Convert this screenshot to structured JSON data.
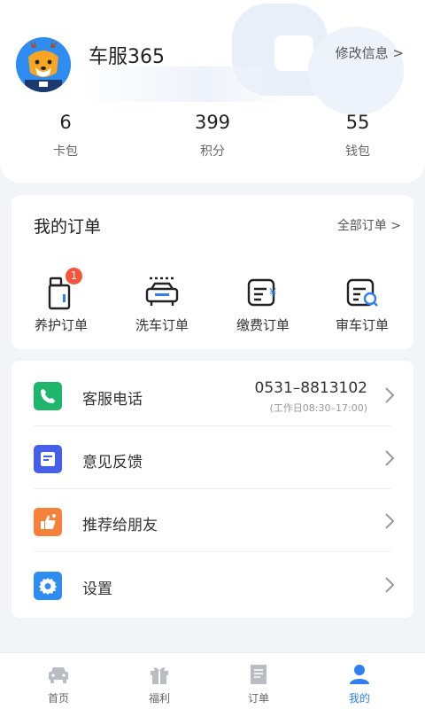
{
  "profile": {
    "username": "车服365",
    "edit_label": "修改信息 >"
  },
  "stats": [
    {
      "value": "6",
      "label": "卡包"
    },
    {
      "value": "399",
      "label": "积分"
    },
    {
      "value": "55",
      "label": "钱包"
    }
  ],
  "orders": {
    "title": "我的订单",
    "all_label": "全部订单 >",
    "items": [
      {
        "label": "养护订单",
        "icon": "maintenance-icon",
        "badge": "1"
      },
      {
        "label": "洗车订单",
        "icon": "car-wash-icon"
      },
      {
        "label": "缴费订单",
        "icon": "payment-icon"
      },
      {
        "label": "审车订单",
        "icon": "inspection-icon"
      }
    ]
  },
  "menu": {
    "items": [
      {
        "label": "客服电话",
        "icon": "phone-icon",
        "color": "#1fb56b",
        "value": "0531–8813102",
        "sub": "(工作日08:30–17:00)"
      },
      {
        "label": "意见反馈",
        "icon": "feedback-icon",
        "color": "#4560e6"
      },
      {
        "label": "推荐给朋友",
        "icon": "thumbs-up-icon",
        "color": "#f5813a"
      },
      {
        "label": "设置",
        "icon": "settings-icon",
        "color": "#2f8cf0"
      }
    ]
  },
  "tabbar": {
    "items": [
      {
        "label": "首页",
        "icon": "car-icon"
      },
      {
        "label": "福利",
        "icon": "gift-icon"
      },
      {
        "label": "订单",
        "icon": "list-icon"
      },
      {
        "label": "我的",
        "icon": "user-icon",
        "active": true
      }
    ]
  },
  "colors": {
    "accent": "#2f7ff0",
    "badge": "#f5553a",
    "background": "#f3f4f8"
  }
}
